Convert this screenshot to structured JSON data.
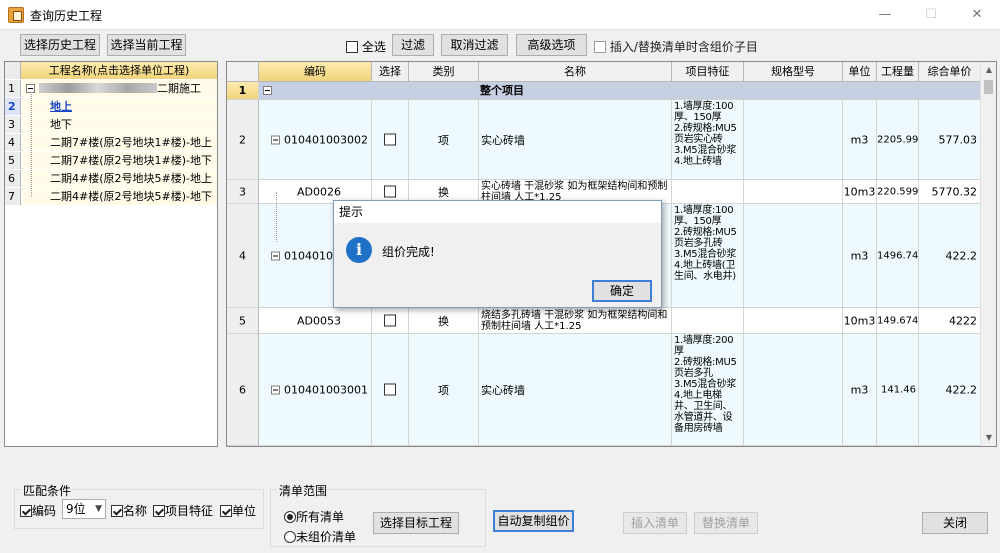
{
  "window": {
    "title": "查询历史工程",
    "minimize": "—",
    "maximize": "☐",
    "close": "✕"
  },
  "toolbar": {
    "select_history": "选择历史工程",
    "select_current": "选择当前工程",
    "select_all": "全选",
    "filter": "过滤",
    "cancel_filter": "取消过滤",
    "advanced": "高级选项",
    "insert_replace_note": "插入/替换清单时含组价子目"
  },
  "left": {
    "header": "工程名称(点击选择单位工程)",
    "rows": [
      {
        "num": "1",
        "name": "二期施工"
      },
      {
        "num": "2",
        "name": "地上"
      },
      {
        "num": "3",
        "name": "地下"
      },
      {
        "num": "4",
        "name": "二期7#楼(原2号地块1#楼)-地上"
      },
      {
        "num": "5",
        "name": "二期7#楼(原2号地块1#楼)-地下"
      },
      {
        "num": "6",
        "name": "二期4#楼(原2号地块5#楼)-地上"
      },
      {
        "num": "7",
        "name": "二期4#楼(原2号地块5#楼)-地下"
      }
    ]
  },
  "grid": {
    "headers": [
      "编码",
      "选择",
      "类别",
      "名称",
      "项目特征",
      "规格型号",
      "单位",
      "工程量",
      "综合单价"
    ],
    "group_row": {
      "num": "1",
      "name": "整个项目"
    },
    "rows": [
      {
        "num": "2",
        "code": "010401003002",
        "type": "项",
        "name": "实心砖墙",
        "feature": "1.墙厚度:100厚、150厚\n2.砖规格:MU5页岩实心砖\n3.M5混合砂浆\n4.地上砖墙",
        "unit": "m3",
        "qty": "2205.99",
        "price": "577.03"
      },
      {
        "num": "3",
        "code": "AD0026",
        "type": "换",
        "name": "实心砖墙 干混砂浆 如为框架结构间和预制柱间墙 人工*1.25",
        "feature": "",
        "unit": "10m3",
        "qty": "220.599",
        "price": "5770.32"
      },
      {
        "num": "4",
        "code": "010401003",
        "type": "",
        "name": "",
        "feature": "1.墙厚度:100厚、150厚\n2.砖规格:MU5页岩多孔砖\n3.M5混合砂浆\n4.地上砖墙(卫生间、水电井)",
        "unit": "m3",
        "qty": "1496.74",
        "price": "422.2"
      },
      {
        "num": "5",
        "code": "AD0053",
        "type": "换",
        "name": "烧结多孔砖墙 干混砂浆 如为框架结构间和预制柱间墙 人工*1.25",
        "feature": "",
        "unit": "10m3",
        "qty": "149.674",
        "price": "4222"
      },
      {
        "num": "6",
        "code": "010401003001",
        "type": "项",
        "name": "实心砖墙",
        "feature": "1.墙厚度:200厚\n2.砖规格:MU5页岩多孔\n3.M5混合砂浆\n4.地上电梯井、卫生间、水管道井、设备用房砖墙",
        "unit": "m3",
        "qty": "141.46",
        "price": "422.2"
      }
    ]
  },
  "dialog": {
    "title": "提示",
    "icon": "i",
    "message": "组价完成!",
    "ok": "确定"
  },
  "bottom": {
    "match_group": "匹配条件",
    "code_label": "编码",
    "digits_value": "9位",
    "name_label": "名称",
    "feature_label": "项目特征",
    "unit_label": "单位",
    "scope_group": "清单范围",
    "all_lists": "所有清单",
    "unpriced_lists": "未组价清单",
    "select_target": "选择目标工程",
    "auto_copy": "自动复制组价",
    "insert_list": "插入清单",
    "replace_list": "替换清单",
    "close": "关闭"
  }
}
